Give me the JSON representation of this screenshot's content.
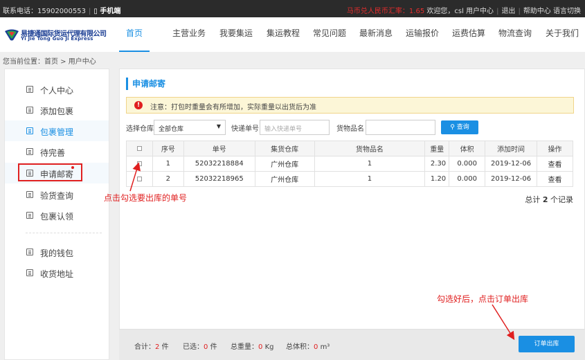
{
  "topbar": {
    "contact": "联系电话：15902000553",
    "sep1": "|",
    "mobile": "手机端",
    "rate": "马币兑人民币汇率：1.65",
    "welcome": "欢迎您，csl",
    "user_center": "用户中心",
    "sep2": "|",
    "logout": "退出",
    "sep3": "|",
    "help": "帮助中心",
    "language": "语言切换"
  },
  "logo": {
    "cn": "易捷通国际货运代理有限公司",
    "en": "Yi Jie Tong Guo Ji Express"
  },
  "nav": [
    "首页",
    "主营业务",
    "我要集运",
    "集运教程",
    "常见问题",
    "最新消息",
    "运输报价",
    "运费估算",
    "物流查询",
    "关于我们"
  ],
  "breadcrumb": "您当前位置：首页 > 用户中心",
  "sidebar": {
    "items": [
      "个人中心",
      "添加包裹",
      "包裹管理",
      "待完善",
      "申请邮寄",
      "验货查询",
      "包裹认领",
      "我的钱包",
      "收货地址"
    ]
  },
  "main": {
    "title": "申请邮寄",
    "notice_icon": "!",
    "notice": "注意：打包时重量会有所增加，实际重量以出货后为准",
    "filter": {
      "warehouse_label": "选择仓库",
      "warehouse_value": "全部仓库",
      "tracking_label": "快递单号",
      "tracking_placeholder": "输入快递单号",
      "goods_label": "货物品名",
      "goods_value": "",
      "query_label": "查询"
    },
    "table": {
      "headers": [
        "",
        "序号",
        "单号",
        "集货仓库",
        "货物品名",
        "重量",
        "体积",
        "添加时间",
        "操作"
      ],
      "rows": [
        {
          "index": "1",
          "number": "52032218884",
          "warehouse": "广州仓库",
          "goods": "1",
          "weight": "2.30",
          "volume": "0.000",
          "date": "2019-12-06",
          "action": "查看"
        },
        {
          "index": "2",
          "number": "52032218965",
          "warehouse": "广州仓库",
          "goods": "1",
          "weight": "1.20",
          "volume": "0.000",
          "date": "2019-12-06",
          "action": "查看"
        }
      ]
    },
    "total_prefix": "总计",
    "total_count": "2",
    "total_suffix": "个记录"
  },
  "annotations": {
    "select_hint": "点击勾选要出库的单号",
    "order_hint": "勾选好后，点击订单出库"
  },
  "footer": {
    "total_label": "合计：",
    "total_value": "2",
    "total_unit": "件",
    "selected_label": "已选：",
    "selected_value": "0",
    "selected_unit": "件",
    "weight_label": "总重量：",
    "weight_value": "0",
    "weight_unit": "Kg",
    "volume_label": "总体积：",
    "volume_value": "0",
    "volume_unit": "m³",
    "order_button": "订单出库"
  },
  "colors": {
    "accent": "#1a8fe3",
    "alert": "#e02020",
    "notice_bg": "#fcf6d7"
  }
}
